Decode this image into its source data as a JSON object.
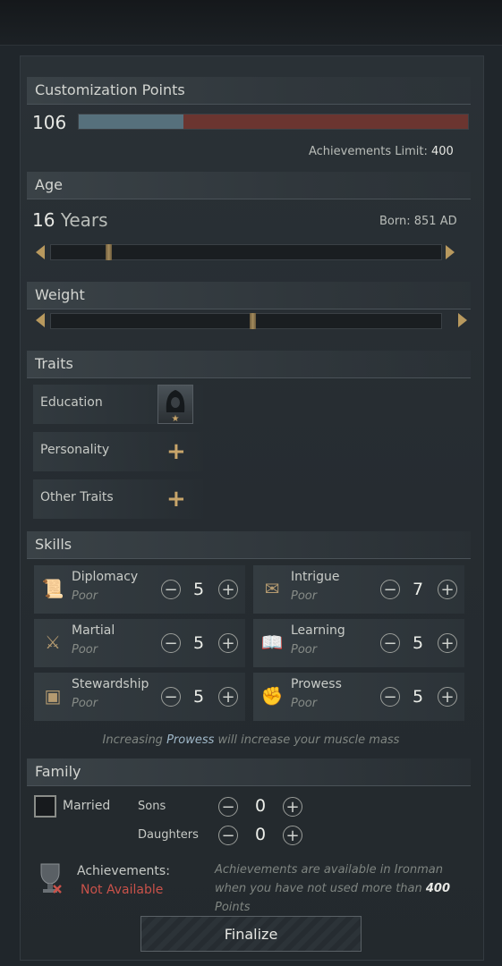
{
  "customization": {
    "header": "Customization Points",
    "points": "106",
    "points_used_fraction": 0.27,
    "limit_label": "Achievements Limit:",
    "limit_value": "400"
  },
  "age": {
    "header": "Age",
    "value": "16",
    "unit": "Years",
    "born_label": "Born:",
    "born_value": "851 AD",
    "slider_fraction": 0.14
  },
  "weight": {
    "header": "Weight",
    "slider_fraction": 0.51
  },
  "traits": {
    "header": "Traits",
    "rows": [
      {
        "label": "Education",
        "icon": "hooded-figure-icon"
      },
      {
        "label": "Personality",
        "icon": "plus-icon"
      },
      {
        "label": "Other Traits",
        "icon": "plus-icon"
      }
    ]
  },
  "skills": {
    "header": "Skills",
    "items": [
      {
        "name": "Diplomacy",
        "level": "Poor",
        "value": "5",
        "icon": "scroll-icon"
      },
      {
        "name": "Intrigue",
        "level": "Poor",
        "value": "7",
        "icon": "dagger-letter-icon"
      },
      {
        "name": "Martial",
        "level": "Poor",
        "value": "5",
        "icon": "crossed-swords-icon"
      },
      {
        "name": "Learning",
        "level": "Poor",
        "value": "5",
        "icon": "book-icon"
      },
      {
        "name": "Stewardship",
        "level": "Poor",
        "value": "5",
        "icon": "chest-icon"
      },
      {
        "name": "Prowess",
        "level": "Poor",
        "value": "5",
        "icon": "arm-icon"
      }
    ],
    "hint_prefix": "Increasing ",
    "hint_highlight": "Prowess",
    "hint_suffix": " will increase your muscle mass"
  },
  "family": {
    "header": "Family",
    "married_label": "Married",
    "sons_label": "Sons",
    "sons_value": "0",
    "daughters_label": "Daughters",
    "daughters_value": "0"
  },
  "achievements": {
    "label": "Achievements:",
    "status": "Not Available",
    "note_part1": "Achievements are available in Ironman when you have not used more than ",
    "note_number": "400",
    "note_part2": " Points"
  },
  "finalize_label": "Finalize",
  "colors": {
    "points_blue": "#56707c",
    "points_red": "#6b3530",
    "gold": "#c8a56a",
    "not_available": "#c9524a",
    "prowess_highlight": "#9fb7c8"
  }
}
